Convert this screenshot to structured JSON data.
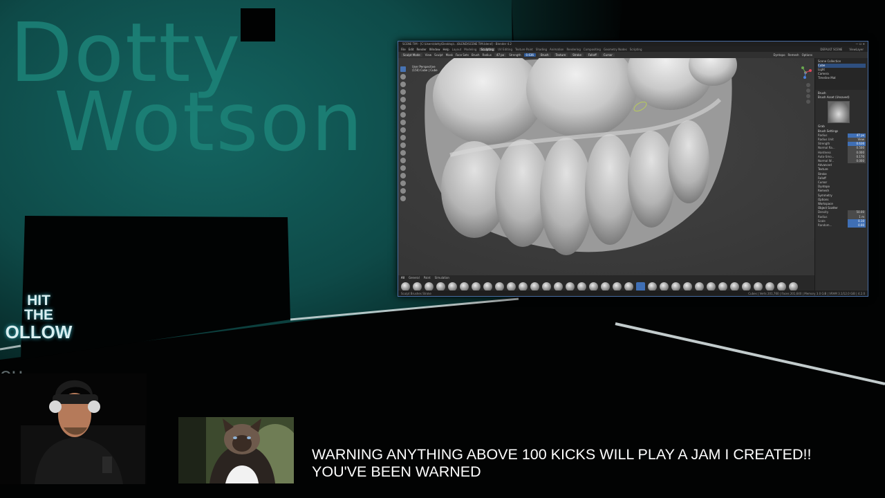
{
  "brand": {
    "line1": "Dotty",
    "line2": "Wotson"
  },
  "follow_sign": {
    "line1": "HIT",
    "line2": "THE",
    "line3": "OLLOW",
    "partial": "ou"
  },
  "blender": {
    "title": "SCENE TIM - [C:\\Users\\dotty\\Desktop\\...\\BLEND\\SCENE TIM.blend] - Blender 4.2",
    "window_controls": "— ☐ ✕",
    "menu": [
      "File",
      "Edit",
      "Render",
      "Window",
      "Help"
    ],
    "workspaces": [
      "Layout",
      "Modeling",
      "Sculpting",
      "UV Editing",
      "Texture Paint",
      "Shading",
      "Animation",
      "Rendering",
      "Compositing",
      "Geometry Nodes",
      "Scripting"
    ],
    "active_workspace": "Sculpting",
    "scene_label": "DEFAULT SCENE",
    "view_layer": "ViewLayer",
    "toolbar": {
      "mode": "Sculpt Mode",
      "view": "View",
      "sculpt": "Sculpt",
      "mask": "Mask",
      "face_sets": "Face Sets",
      "brush": "Brush",
      "radius_label": "Radius",
      "radius": "47 px",
      "strength_label": "Strength",
      "strength": "0.636",
      "brush_menu": "Brush",
      "texture": "Texture",
      "stroke": "Stroke",
      "falloff": "Falloff",
      "cursor": "Cursor",
      "dyntopo": "Dyntopo",
      "remesh": "Remesh",
      "options": "Options"
    },
    "viewport_label": {
      "line1": "User Perspective",
      "line2": "(150) Cube | Cube"
    },
    "outliner_rows": [
      "Scene Collection",
      "Cube",
      "Light",
      "Camera",
      "Timeline Mat"
    ],
    "properties": {
      "brush_header": "Brush",
      "brush_asset": "Brush Asset (Unsaved)",
      "brush_name": "Grab",
      "settings_header": "Brush Settings",
      "rows": [
        {
          "label": "Radius",
          "value": "47 px",
          "highlight": true
        },
        {
          "label": "Radius Unit",
          "value": "View",
          "highlight": false
        },
        {
          "label": "Strength",
          "value": "0.636",
          "highlight": true
        },
        {
          "label": "Normal Ra...",
          "value": "0.500",
          "highlight": false
        },
        {
          "label": "Hardness",
          "value": "0.000",
          "highlight": false
        },
        {
          "label": "Auto-Smo...",
          "value": "0.170",
          "highlight": false
        },
        {
          "label": "Normal W...",
          "value": "0.000",
          "highlight": false
        }
      ],
      "sections": [
        "Advanced",
        "Texture",
        "Stroke",
        "Falloff",
        "Cursor",
        "Dyntopo",
        "Remesh",
        "Symmetry",
        "Options",
        "Workspace",
        "Object Scatter"
      ],
      "scatter_rows": [
        {
          "label": "Density",
          "value": "50.00"
        },
        {
          "label": "Radius",
          "value": "1 m"
        },
        {
          "label": "Scale",
          "value": "0.10"
        },
        {
          "label": "Random...",
          "value": "0.00"
        }
      ]
    },
    "shelf_tabs": [
      "All",
      "General",
      "Paint",
      "Simulation"
    ],
    "status_left": "Sculpt   Brushes   Stroke",
    "status_right": "Cubes | Verts 201,760 | Faces 201,640 | Memory 3.0 GiB | VRAM 3.1/12.0 GiB | 4.2.0"
  },
  "warning": {
    "line1": "WARNING ANYTHING ABOVE 100 KICKS WILL PLAY A JAM I CREATED!!",
    "line2": "YOU'VE BEEN WARNED"
  },
  "colors": {
    "teal_text": "#1d8479",
    "teal_wall": "#0f4c4a",
    "blender_bg": "#3a3a3a",
    "selection_blue": "#3f6fb5",
    "overlay_text": "#ffffff"
  }
}
